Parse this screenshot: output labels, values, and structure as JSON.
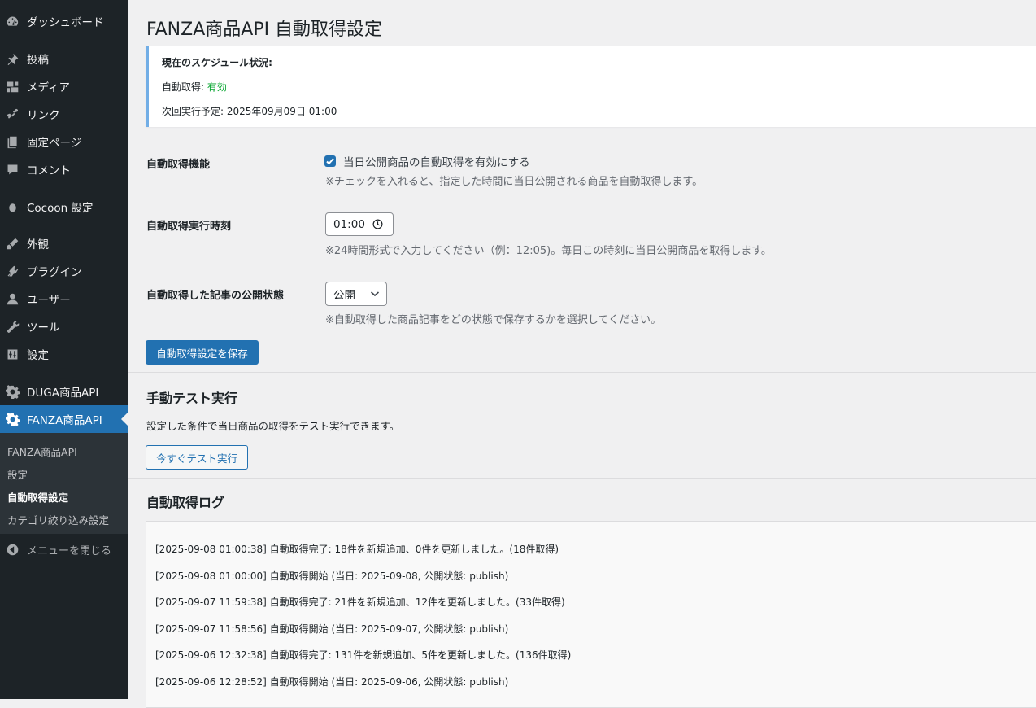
{
  "sidebar": {
    "items": [
      {
        "label": "ダッシュボード",
        "icon": "dashboard-icon"
      },
      {
        "label": "投稿",
        "icon": "pin-icon"
      },
      {
        "label": "メディア",
        "icon": "media-icon"
      },
      {
        "label": "リンク",
        "icon": "link-icon"
      },
      {
        "label": "固定ページ",
        "icon": "pages-icon"
      },
      {
        "label": "コメント",
        "icon": "comment-icon"
      },
      {
        "label": "Cocoon 設定",
        "icon": "cocoon-icon"
      },
      {
        "label": "外観",
        "icon": "appearance-icon"
      },
      {
        "label": "プラグイン",
        "icon": "plugin-icon"
      },
      {
        "label": "ユーザー",
        "icon": "user-icon"
      },
      {
        "label": "ツール",
        "icon": "wrench-icon"
      },
      {
        "label": "設定",
        "icon": "settings-icon"
      },
      {
        "label": "DUGA商品API",
        "icon": "gear-icon"
      },
      {
        "label": "FANZA商品API",
        "icon": "gear-icon"
      }
    ],
    "submenu": [
      {
        "label": "FANZA商品API"
      },
      {
        "label": "設定"
      },
      {
        "label": "自動取得設定"
      },
      {
        "label": "カテゴリ絞り込み設定"
      }
    ],
    "collapse_label": "メニューを閉じる"
  },
  "page": {
    "title": "FANZA商品API 自動取得設定"
  },
  "notice": {
    "heading": "現在のスケジュール状況:",
    "auto_label": "自動取得: ",
    "auto_value": "有効",
    "next_run": "次回実行予定: 2025年09月09日 01:00"
  },
  "form": {
    "enable_label": "自動取得機能",
    "enable_checkbox_label": "当日公開商品の自動取得を有効にする",
    "enable_desc": "※チェックを入れると、指定した時間に当日公開される商品を自動取得します。",
    "time_label": "自動取得実行時刻",
    "time_value": "01:00",
    "time_desc": "※24時間形式で入力してください（例：12:05)。毎日この時刻に当日公開商品を取得します。",
    "status_label": "自動取得した記事の公開状態",
    "status_value": "公開",
    "status_desc": "※自動取得した商品記事をどの状態で保存するかを選択してください。",
    "save_button": "自動取得設定を保存"
  },
  "manual": {
    "title": "手動テスト実行",
    "desc": "設定した条件で当日商品の取得をテスト実行できます。",
    "button": "今すぐテスト実行"
  },
  "log": {
    "title": "自動取得ログ",
    "lines": [
      "[2025-09-08 01:00:38] 自動取得完了: 18件を新規追加、0件を更新しました。(18件取得)",
      "[2025-09-08 01:00:00] 自動取得開始 (当日: 2025-09-08, 公開状態: publish)",
      "[2025-09-07 11:59:38] 自動取得完了: 21件を新規追加、12件を更新しました。(33件取得)",
      "[2025-09-07 11:58:56] 自動取得開始 (当日: 2025-09-07, 公開状態: publish)",
      "[2025-09-06 12:32:38] 自動取得完了: 131件を新規追加、5件を更新しました。(136件取得)",
      "[2025-09-06 12:28:52] 自動取得開始 (当日: 2025-09-06, 公開状態: publish)"
    ]
  },
  "colors": {
    "accent": "#2271b1",
    "sidebar_bg": "#1d2327",
    "status_ok": "#00a32a"
  }
}
